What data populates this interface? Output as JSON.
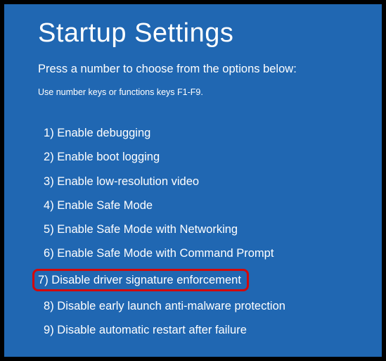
{
  "title": "Startup Settings",
  "instruction": "Press a number to choose from the options below:",
  "hint": "Use number keys or functions keys F1-F9.",
  "options": [
    {
      "num": "1",
      "label": "Enable debugging",
      "highlighted": false
    },
    {
      "num": "2",
      "label": "Enable boot logging",
      "highlighted": false
    },
    {
      "num": "3",
      "label": "Enable low-resolution video",
      "highlighted": false
    },
    {
      "num": "4",
      "label": "Enable Safe Mode",
      "highlighted": false
    },
    {
      "num": "5",
      "label": "Enable Safe Mode with Networking",
      "highlighted": false
    },
    {
      "num": "6",
      "label": "Enable Safe Mode with Command Prompt",
      "highlighted": false
    },
    {
      "num": "7",
      "label": "Disable driver signature enforcement",
      "highlighted": true
    },
    {
      "num": "8",
      "label": "Disable early launch anti-malware protection",
      "highlighted": false
    },
    {
      "num": "9",
      "label": "Disable automatic restart after failure",
      "highlighted": false
    }
  ]
}
